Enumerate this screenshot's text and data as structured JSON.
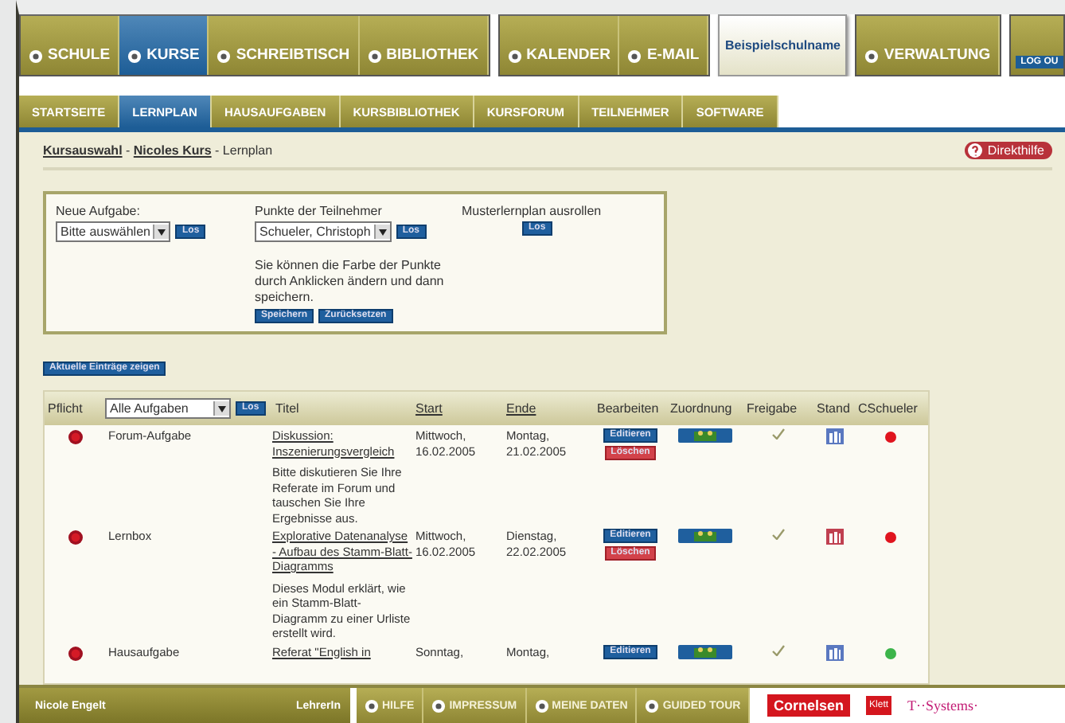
{
  "main_nav": [
    [
      {
        "label": "SCHULE",
        "selected": false
      },
      {
        "label": "KURSE",
        "selected": true
      },
      {
        "label": "SCHREIBTISCH",
        "selected": false
      },
      {
        "label": "BIBLIOTHEK",
        "selected": false
      }
    ],
    [
      {
        "label": "KALENDER",
        "selected": false
      },
      {
        "label": "E-MAIL",
        "selected": false
      }
    ]
  ],
  "school_name": "Beispielschulname",
  "admin_nav": {
    "label": "VERWALTUNG"
  },
  "logout": "LOG OU",
  "sub_tabs": [
    {
      "label": "STARTSEITE",
      "selected": false
    },
    {
      "label": "LERNPLAN",
      "selected": true
    },
    {
      "label": "HAUSAUFGABEN",
      "selected": false
    },
    {
      "label": "KURSBIBLIOTHEK",
      "selected": false
    },
    {
      "label": "KURSFORUM",
      "selected": false
    },
    {
      "label": "TEILNEHMER",
      "selected": false
    },
    {
      "label": "SOFTWARE",
      "selected": false
    }
  ],
  "breadcrumb": [
    {
      "label": "Kursauswahl",
      "kind": "link"
    },
    {
      "label": " - ",
      "kind": "text"
    },
    {
      "label": "Nicoles Kurs",
      "kind": "link"
    },
    {
      "label": " - Lernplan",
      "kind": "text"
    }
  ],
  "help_button": "Direkthilfe",
  "form": {
    "new_task": {
      "label": "Neue Aufgabe:",
      "value": "Bitte auswählen",
      "button": "Los"
    },
    "participant_points": {
      "label": "Punkte der Teilnehmer",
      "value": "Schueler, Christoph",
      "button": "Los",
      "hint": "Sie können die Farbe der Punkte durch Anklicken ändern und dann speichern.",
      "buttons": [
        "Speichern",
        "Zurücksetzen"
      ]
    },
    "sample_plan": {
      "label": "Musterlernplan ausrollen",
      "button": "Los"
    }
  },
  "show_current_button": "Aktuelle Einträge zeigen",
  "table": {
    "filter": {
      "value": "Alle Aufgaben",
      "button": "Los"
    },
    "columns": [
      {
        "label": "Pflicht",
        "kind": "plain"
      },
      {
        "label": "Titel",
        "kind": "plain"
      },
      {
        "label": "Start",
        "kind": "link"
      },
      {
        "label": "Ende",
        "kind": "link"
      },
      {
        "label": "Bearbeiten",
        "kind": "plain"
      },
      {
        "label": "Zuordnung",
        "kind": "plain"
      },
      {
        "label": "Freigabe",
        "kind": "plain"
      },
      {
        "label": "Stand",
        "kind": "plain"
      },
      {
        "label": "CSchueler",
        "kind": "plain"
      }
    ],
    "rows": [
      {
        "type": "Forum-Aufgabe",
        "title": "Diskussion: Inszenierungsvergleich",
        "description": "Bitte diskutieren Sie Ihre Referate im Forum und tauschen Sie Ihre Ergebnisse aus.",
        "start": "Mittwoch, 16.02.2005",
        "end": "Montag, 21.02.2005",
        "edit_buttons": [
          "Editieren",
          "Löschen"
        ],
        "released": true,
        "stand": {
          "color": "#5a78c0"
        },
        "color": "#e0141e"
      },
      {
        "type": "Lernbox",
        "title": "Explorative Datenanalyse - Aufbau des Stamm-Blatt-Diagramms",
        "description": "Dieses Modul erklärt, wie ein Stamm-Blatt-Diagramm zu einer Urliste erstellt wird.",
        "start": "Mittwoch, 16.02.2005",
        "end": "Dienstag, 22.02.2005",
        "edit_buttons": [
          "Editieren",
          "Löschen"
        ],
        "released": true,
        "stand": {
          "color": "#c04050"
        },
        "color": "#e0141e"
      },
      {
        "type": "Hausaufgabe",
        "title": "Referat \"English in",
        "start": "Sonntag,",
        "end": "Montag,",
        "edit_buttons": [
          "Editieren"
        ],
        "released": true,
        "stand": {
          "color": "#5a78c0"
        },
        "color": "#3cb44a"
      }
    ]
  },
  "footer": {
    "user": "Nicole Engelt",
    "role": "LehrerIn",
    "links": [
      "HILFE",
      "IMPRESSUM",
      "MEINE DATEN",
      "GUIDED TOUR"
    ],
    "partners": [
      "Cornelsen",
      "Klett",
      "T··Systems·"
    ]
  }
}
